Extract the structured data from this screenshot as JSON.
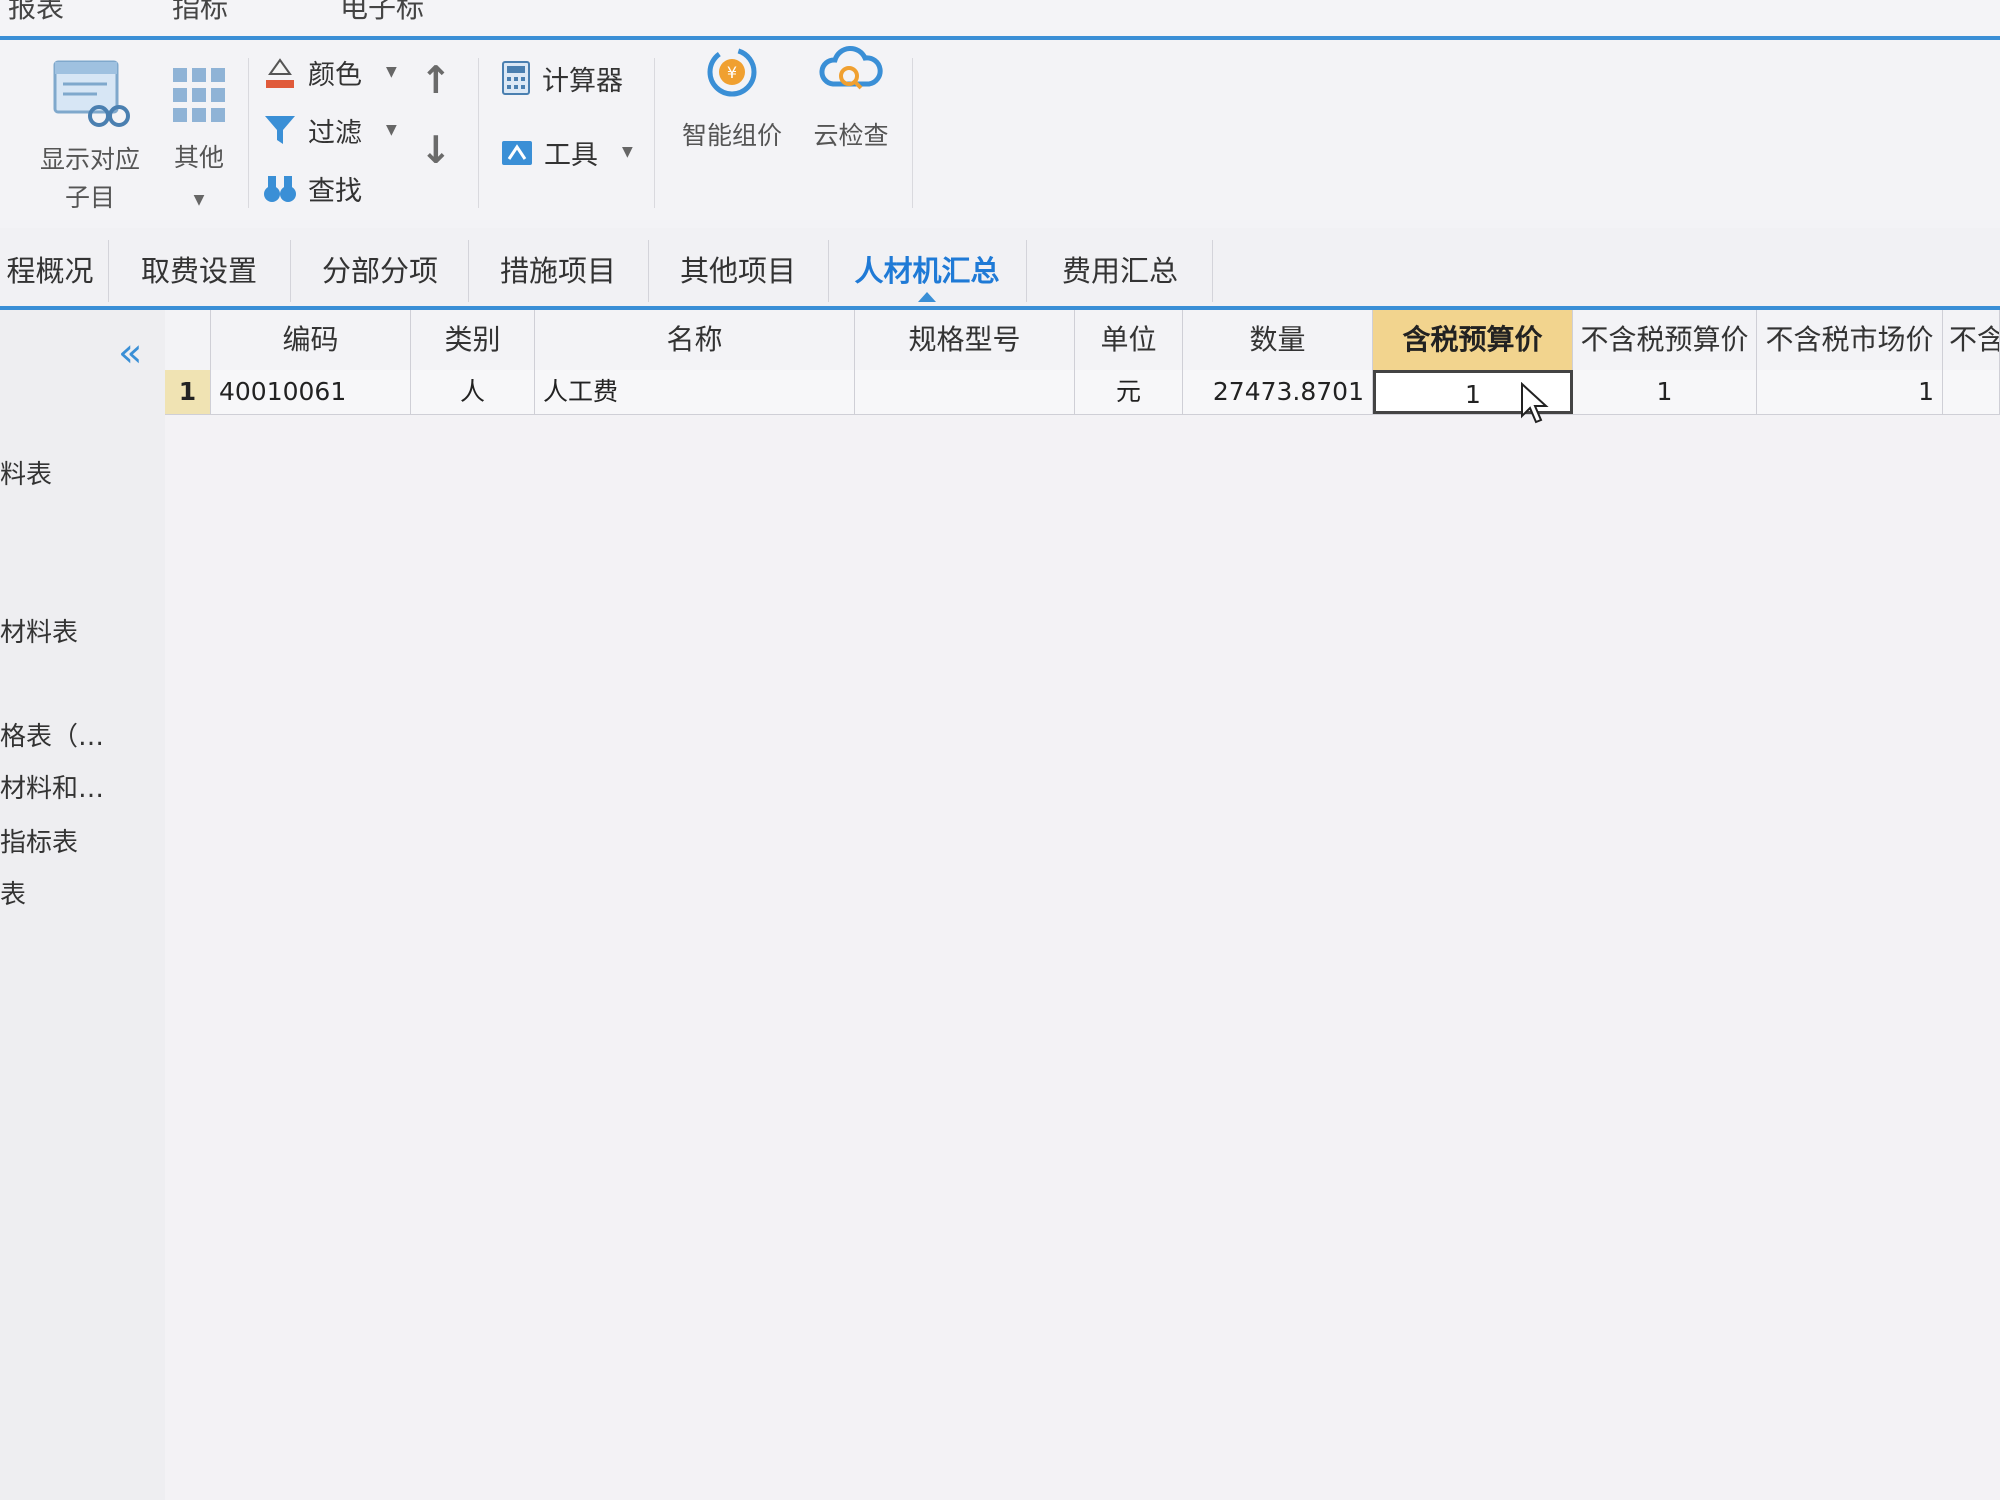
{
  "menu": {
    "items": [
      "报表",
      "指标",
      "电子标"
    ]
  },
  "ribbon": {
    "show_sub_items": {
      "line1": "显示对应",
      "line2": "子目"
    },
    "other": "其他",
    "color": "颜色",
    "filter": "过滤",
    "find": "查找",
    "calculator": "计算器",
    "tools": "工具",
    "smart_pricing": "智能组价",
    "cloud_check": "云检查"
  },
  "tabs": [
    {
      "label": "程概况"
    },
    {
      "label": "取费设置"
    },
    {
      "label": "分部分项"
    },
    {
      "label": "措施项目"
    },
    {
      "label": "其他项目"
    },
    {
      "label": "人材机汇总"
    },
    {
      "label": "费用汇总"
    }
  ],
  "active_tab": "人材机汇总",
  "sidebar": {
    "items": [
      "料表",
      "材料表",
      "格表（…",
      "材料和…",
      "指标表",
      "表"
    ]
  },
  "table": {
    "headers": [
      "编码",
      "类别",
      "名称",
      "规格型号",
      "单位",
      "数量",
      "含税预算价",
      "不含税预算价",
      "不含税市场价",
      "不含"
    ],
    "rows": [
      {
        "num": "1",
        "code": "40010061",
        "category": "人",
        "name": "人工费",
        "spec": "",
        "unit": "元",
        "quantity": "27473.8701",
        "tax_budget_price": "1",
        "no_tax_budget_price": "1",
        "no_tax_market_price": "1",
        "extra": ""
      }
    ]
  },
  "colors": {
    "accent": "#3a8fd6",
    "highlight_header": "#f2d48e",
    "row_number": "#f0e3b3"
  }
}
